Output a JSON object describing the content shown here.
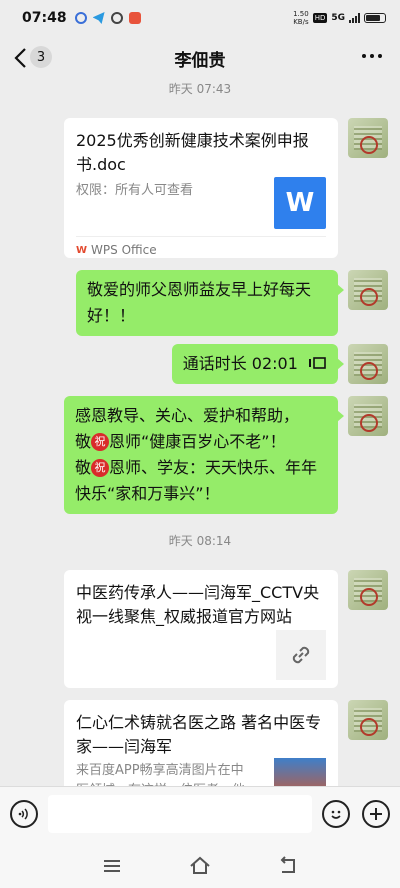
{
  "status_bar": {
    "time": "07:48",
    "net_speed_value": "1.50",
    "net_speed_unit": "KB/s",
    "hd": "HD",
    "network": "5G",
    "battery_level": 0.8
  },
  "header": {
    "back_count": "3",
    "title": "李佃贵"
  },
  "timestamps": [
    "昨天 07:43",
    "昨天 08:14"
  ],
  "messages": {
    "file": {
      "title": "2025优秀创新健康技术案例申报书.doc",
      "permission": "权限：所有人可查看",
      "source": "WPS Office",
      "thumb_letter": "W"
    },
    "msg1": "敬爱的师父恩师益友早上好每天好！！",
    "call": {
      "text": "通话时长 02:01"
    },
    "msg3": {
      "line1": "感恩教导、关心、爱护和帮助，",
      "l2_a": "敬",
      "zhu": "祝",
      "l2_b": "恩师“健康百岁心不老”！",
      "l3_a": "敬",
      "l3_b": "恩师、学友：天天快乐、年年快乐“家和万事兴”！"
    },
    "link1": {
      "title": "中医药传承人——闫海军_CCTV央视一线聚焦_权威报道官方网站"
    },
    "link2": {
      "title": "仁心仁术铸就名医之路 著名中医专家——闫海军",
      "desc": "来百度APP畅享高清图片在中医领域，有这样一位医者，他"
    }
  },
  "input": {
    "placeholder": ""
  },
  "colors": {
    "bubble": "#95ec69",
    "background": "#ededed",
    "wps": "#2f80ed"
  }
}
